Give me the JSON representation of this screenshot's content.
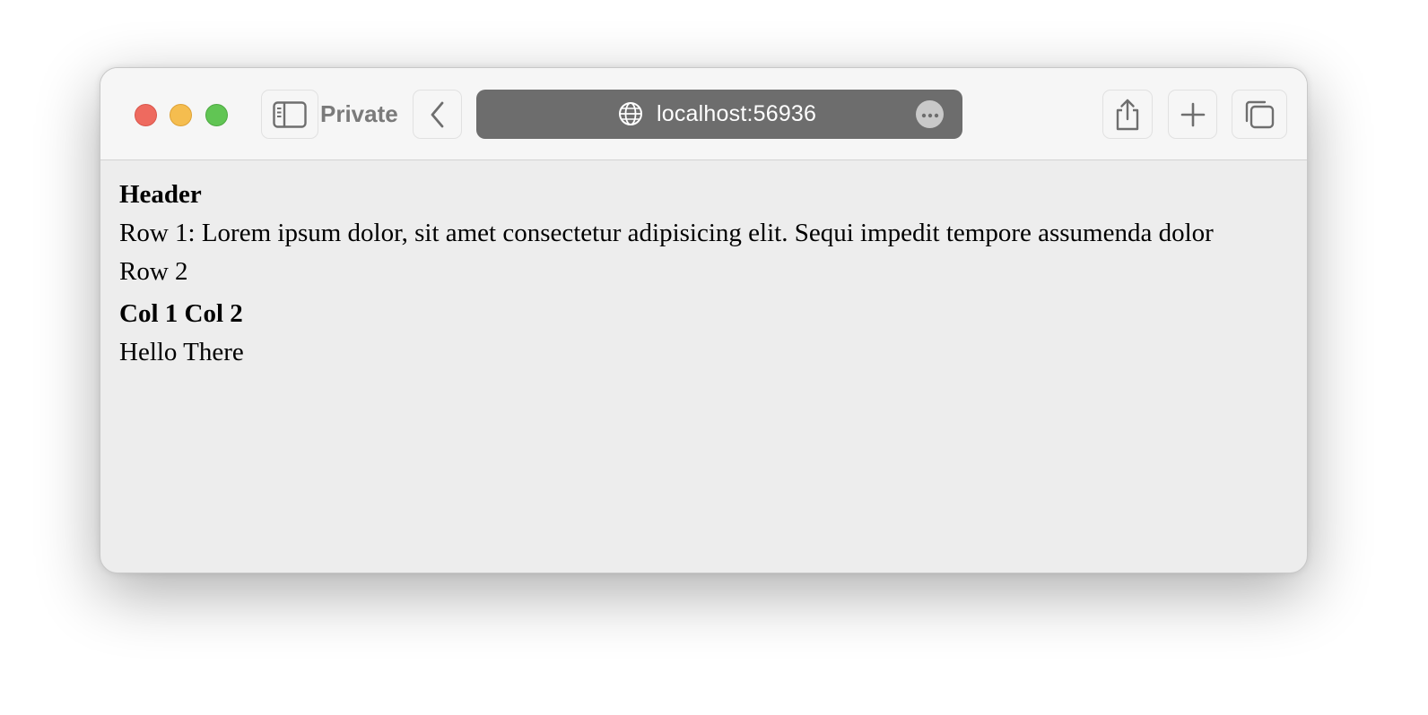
{
  "browser": {
    "private_label": "Private",
    "url": "localhost:56936",
    "icons": {
      "sidebar": "sidebar-icon",
      "back": "chevron-left-icon",
      "globe": "globe-icon",
      "more": "ellipsis-icon",
      "share": "share-icon",
      "new_tab": "plus-icon",
      "tabs": "tab-overview-icon"
    },
    "colors": {
      "close": "#ee6a5f",
      "minimize": "#f5bd4f",
      "zoom": "#61c554",
      "address_bar": "#6d6d6d"
    }
  },
  "page": {
    "header": "Header",
    "row1": "Row 1: Lorem ipsum dolor, sit amet consectetur adipisicing elit. Sequi impedit tempore assumenda dolor",
    "row2": "Row 2",
    "col_header": "Col 1 Col 2",
    "body_text": "Hello There"
  }
}
